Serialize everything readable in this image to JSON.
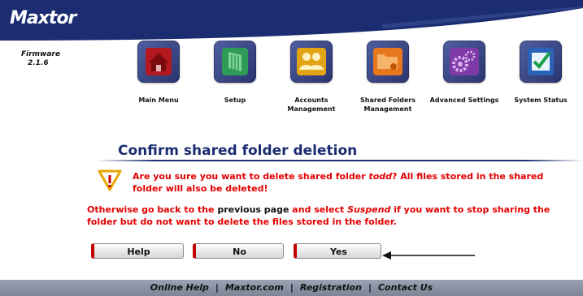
{
  "brand": {
    "logo": "Maxtor",
    "firmware_label": "Firmware",
    "firmware_version": "2.1.6"
  },
  "nav": [
    {
      "label": "Main Menu",
      "icon": "home-icon",
      "color": "#b3191e"
    },
    {
      "label": "Setup",
      "icon": "setup-icon",
      "color": "#2e9a55"
    },
    {
      "label": "Accounts Management",
      "icon": "users-icon",
      "color": "#e3a413"
    },
    {
      "label": "Shared Folders Management",
      "icon": "shared-folders-icon",
      "color": "#e6771c"
    },
    {
      "label": "Advanced Settings",
      "icon": "gears-icon",
      "color": "#7d3aa6"
    },
    {
      "label": "System Status",
      "icon": "checkmark-icon",
      "color": "#2a63b5"
    }
  ],
  "dialog": {
    "title": "Confirm shared folder deletion",
    "question_a": "Are you sure you want to delete shared folder ",
    "folder": "todd",
    "question_b": "? All files stored in the shared folder will also be deleted!",
    "other_a": "Otherwise go back to the ",
    "other_link": "previous page",
    "other_b": " and select ",
    "other_suspend": "Suspend",
    "other_c": " if you want to stop sharing the folder but do not want to delete the files stored in the folder."
  },
  "buttons": {
    "help": "Help",
    "no": "No",
    "yes": "Yes"
  },
  "footer": {
    "online_help": "Online Help",
    "maxtor_com": "Maxtor.com",
    "registration": "Registration",
    "contact_us": "Contact Us",
    "separator": "|"
  },
  "colors": {
    "header": "#1b2d70",
    "warning_text": "#e30000",
    "button_accent": "#c30000"
  }
}
